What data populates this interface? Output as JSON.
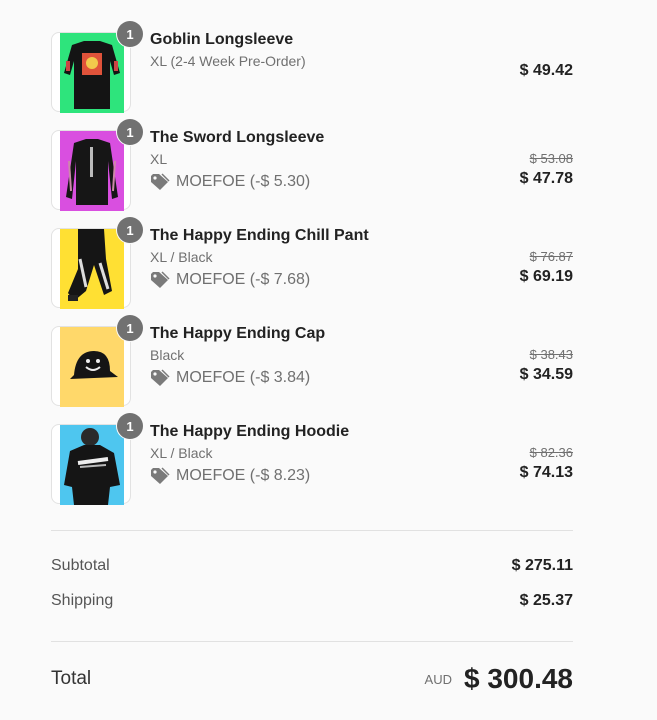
{
  "items": [
    {
      "quantity": "1",
      "name": "Goblin Longsleeve",
      "variant": "XL (2-4 Week Pre-Order)",
      "discount": "",
      "original_price": "",
      "price": "$ 49.42",
      "image_bg": "#2ee47c"
    },
    {
      "quantity": "1",
      "name": "The Sword Longsleeve",
      "variant": "XL",
      "discount": "MOEFOE (-$ 5.30)",
      "original_price": "$ 53.08",
      "price": "$ 47.78",
      "image_bg": "#d94fe0"
    },
    {
      "quantity": "1",
      "name": "The Happy Ending Chill Pant",
      "variant": "XL / Black",
      "discount": "MOEFOE (-$ 7.68)",
      "original_price": "$ 76.87",
      "price": "$ 69.19",
      "image_bg": "#ffe033"
    },
    {
      "quantity": "1",
      "name": "The Happy Ending Cap",
      "variant": "Black",
      "discount": "MOEFOE (-$ 3.84)",
      "original_price": "$ 38.43",
      "price": "$ 34.59",
      "image_bg": "#ffd86a"
    },
    {
      "quantity": "1",
      "name": "The Happy Ending Hoodie",
      "variant": "XL / Black",
      "discount": "MOEFOE (-$ 8.23)",
      "original_price": "$ 82.36",
      "price": "$ 74.13",
      "image_bg": "#4ec6ef"
    }
  ],
  "summary": {
    "subtotal_label": "Subtotal",
    "subtotal_value": "$ 275.11",
    "shipping_label": "Shipping",
    "shipping_value": "$ 25.37",
    "total_label": "Total",
    "currency": "AUD",
    "total_value": "$ 300.48"
  }
}
